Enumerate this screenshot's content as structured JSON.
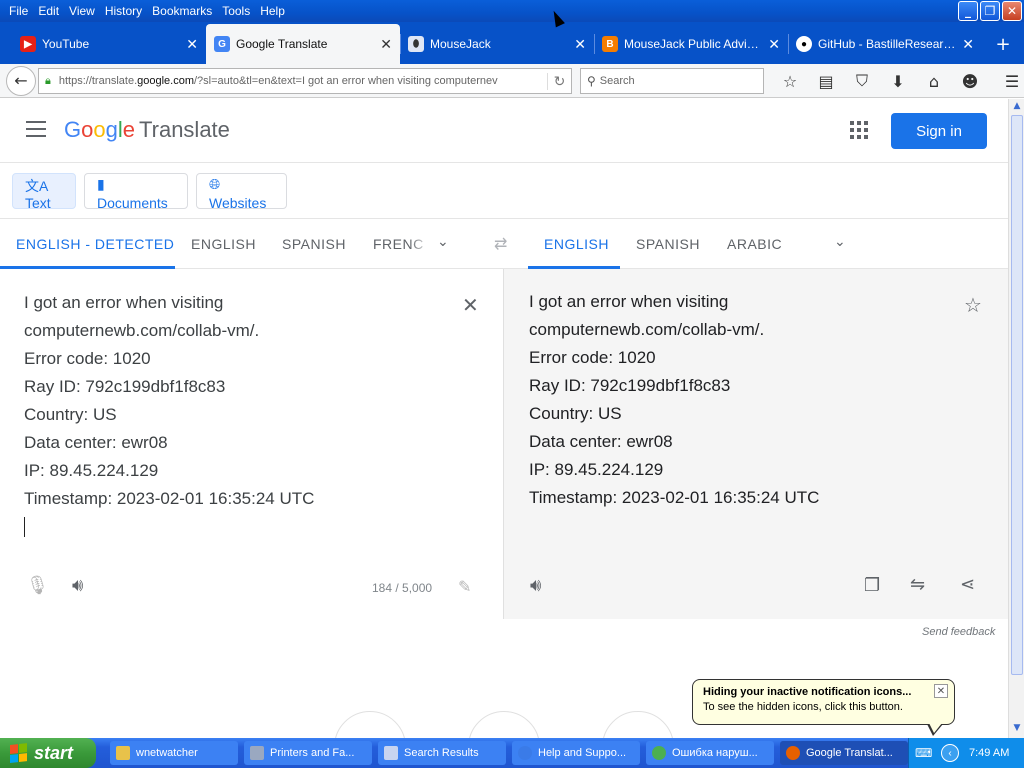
{
  "menu": [
    "File",
    "Edit",
    "View",
    "History",
    "Bookmarks",
    "Tools",
    "Help"
  ],
  "tabs": [
    {
      "title": "YouTube",
      "icon": "youtube-icon",
      "color": "#e62117"
    },
    {
      "title": "Google Translate",
      "icon": "google-translate-icon",
      "color": "#4285f4"
    },
    {
      "title": "MouseJack",
      "icon": "mousejack-icon",
      "color": "#333333"
    },
    {
      "title": "MouseJack Public Advisori...",
      "icon": "blogger-icon",
      "color": "#f57d00"
    },
    {
      "title": "GitHub - BastilleResearch/...",
      "icon": "github-icon",
      "color": "#000000"
    }
  ],
  "url": {
    "prefix": "https://translate.",
    "domain": "google.com",
    "suffix": "/?sl=auto&tl=en&text=I got an error when visiting computernev"
  },
  "search_placeholder": "Search",
  "gt": {
    "logo_google": [
      "G",
      "o",
      "o",
      "g",
      "l",
      "e"
    ],
    "logo_translate": "Translate",
    "signin": "Sign in",
    "modes": [
      "Text",
      "Documents",
      "Websites"
    ],
    "source_langs": [
      "ENGLISH - DETECTED",
      "ENGLISH",
      "SPANISH",
      "FRENC"
    ],
    "target_langs": [
      "ENGLISH",
      "SPANISH",
      "ARABIC"
    ],
    "source_lines": [
      "I got an error when visiting",
      "computernewb.com/collab-vm/.",
      "Error code: 1020",
      "Ray ID: 792c199dbf1f8c83",
      "Country: US",
      "Data center: ewr08",
      "IP: 89.45.224.129",
      "Timestamp: 2023-02-01 16:35:24 UTC"
    ],
    "target_lines": [
      "I got an error when visiting",
      "computernewb.com/collab-vm/.",
      "Error code: 1020",
      "Ray ID: 792c199dbf1f8c83",
      "Country: US",
      "Data center: ewr08",
      "IP: 89.45.224.129",
      "Timestamp: 2023-02-01 16:35:24 UTC"
    ],
    "char_count": "184 / 5,000",
    "send_feedback": "Send feedback"
  },
  "balloon": {
    "title": "Hiding your inactive notification icons...",
    "text": "To see the hidden icons, click this button."
  },
  "taskbar": {
    "start": "start",
    "tasks": [
      {
        "label": "wnetwatcher",
        "color": "#e8c24a"
      },
      {
        "label": "Printers and Fa...",
        "color": "#9aa8c0"
      },
      {
        "label": "Search Results",
        "color": "#c8d4f0"
      },
      {
        "label": "Help and Suppo...",
        "color": "#3a7be8"
      },
      {
        "label": "Ошибка наруш...",
        "color": "#4caf50"
      },
      {
        "label": "Google Translat...",
        "color": "#e66000"
      }
    ],
    "clock": "7:49 AM"
  },
  "colors": {
    "accent": "#1a73e8",
    "xp_blue": "#0752c8",
    "start_green": "#3a9a3a"
  }
}
